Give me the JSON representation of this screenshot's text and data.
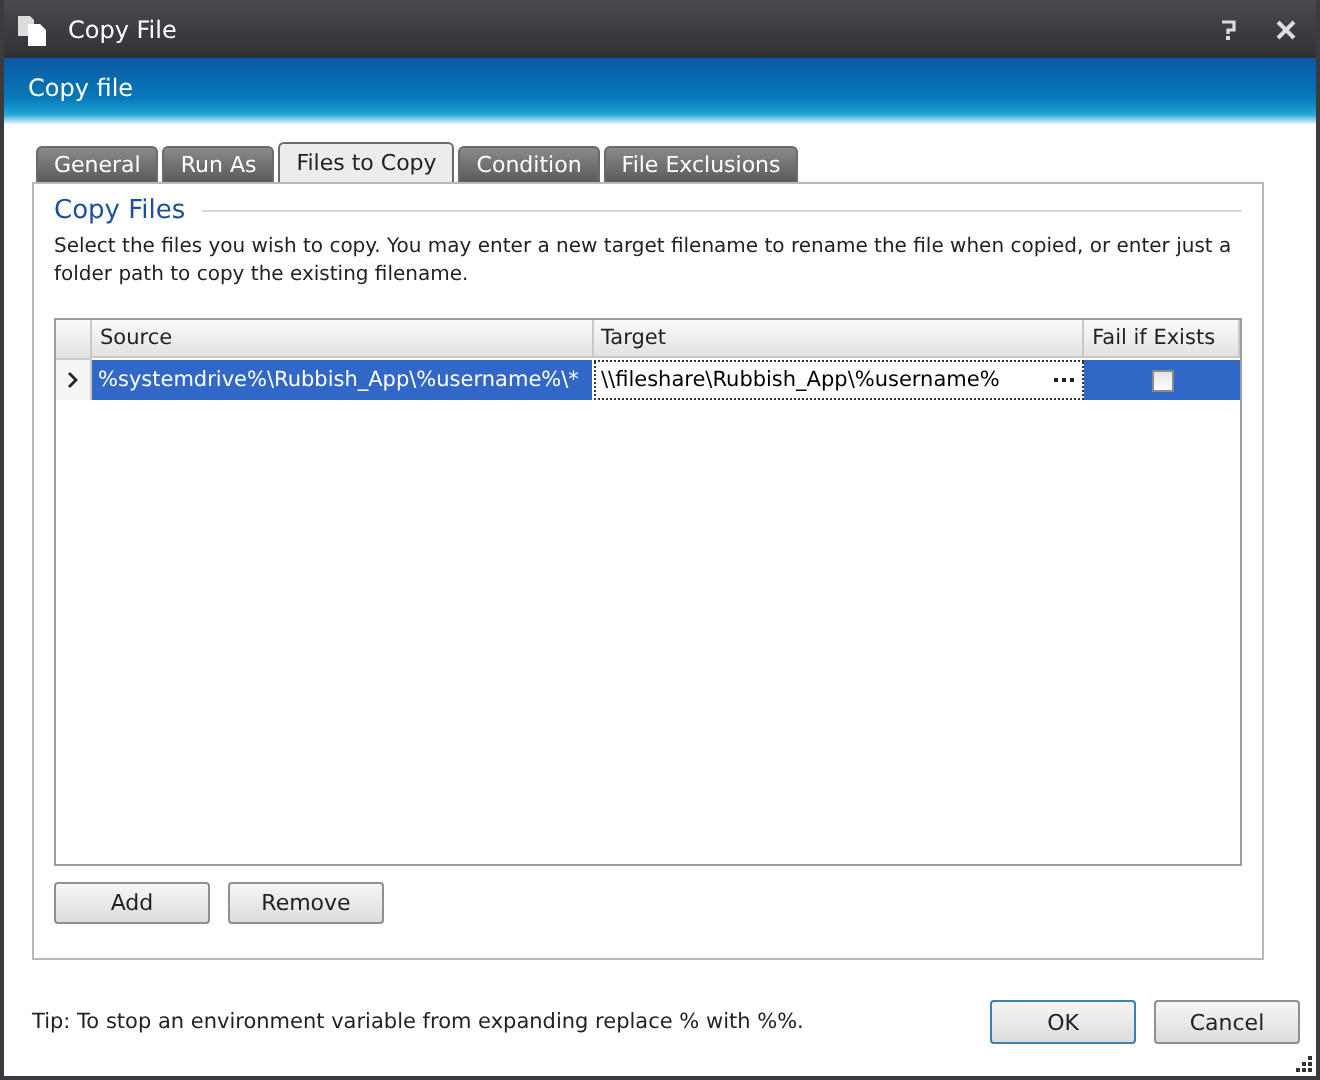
{
  "window": {
    "title": "Copy File"
  },
  "header": {
    "title": "Copy file"
  },
  "tabs": [
    {
      "label": "General",
      "selected": false
    },
    {
      "label": "Run As",
      "selected": false
    },
    {
      "label": "Files to Copy",
      "selected": true
    },
    {
      "label": "Condition",
      "selected": false
    },
    {
      "label": "File Exclusions",
      "selected": false
    }
  ],
  "section": {
    "title": "Copy Files",
    "description": "Select the files you wish to copy. You may enter a new target filename to rename the file when copied, or enter just a folder path to copy the existing filename."
  },
  "table": {
    "columns": [
      "Source",
      "Target",
      "Fail if Exists"
    ],
    "rows": [
      {
        "source": "%systemdrive%\\Rubbish_App\\%username%\\*",
        "target": "\\\\fileshare\\Rubbish_App\\%username%",
        "fail_if_exists": false,
        "selected": true
      }
    ]
  },
  "grid_buttons": [
    "Add",
    "Remove"
  ],
  "tip": "Tip: To stop an environment variable from expanding replace % with %%.",
  "buttons": [
    {
      "label": "OK",
      "default": true
    },
    {
      "label": "Cancel",
      "default": false
    }
  ]
}
